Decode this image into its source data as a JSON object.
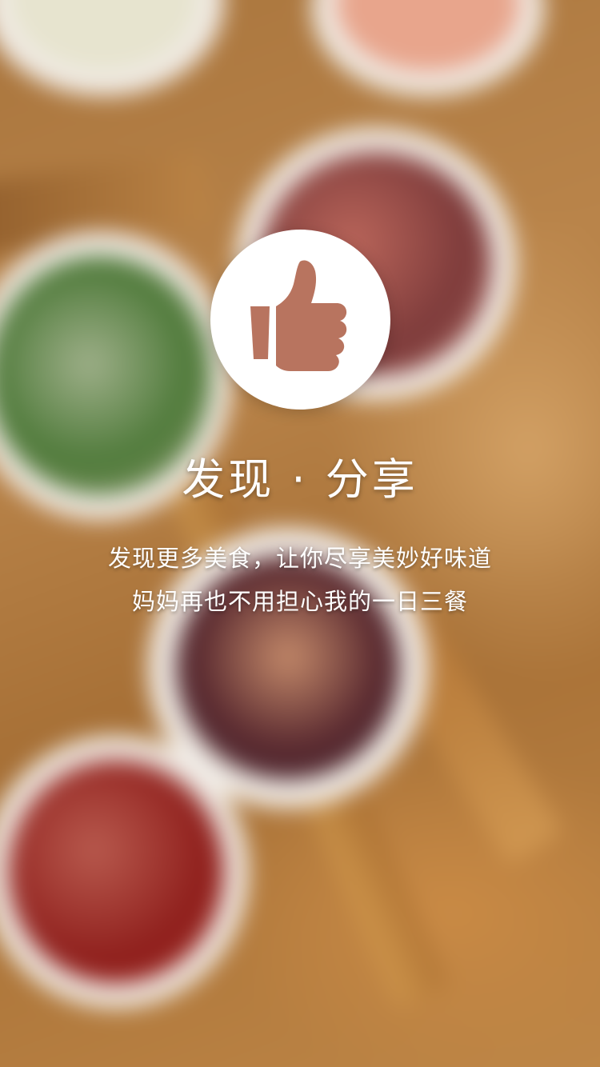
{
  "splash": {
    "icon": "thumbs-up-icon",
    "title": "发现 · 分享",
    "tagline_line1": "发现更多美食，让你尽享美妙好味道",
    "tagline_line2": "妈妈再也不用担心我的一日三餐"
  },
  "colors": {
    "icon_fill": "#b8745f",
    "badge_background": "#ffffff",
    "text": "#ffffff"
  },
  "background": "blurred-food-photo"
}
